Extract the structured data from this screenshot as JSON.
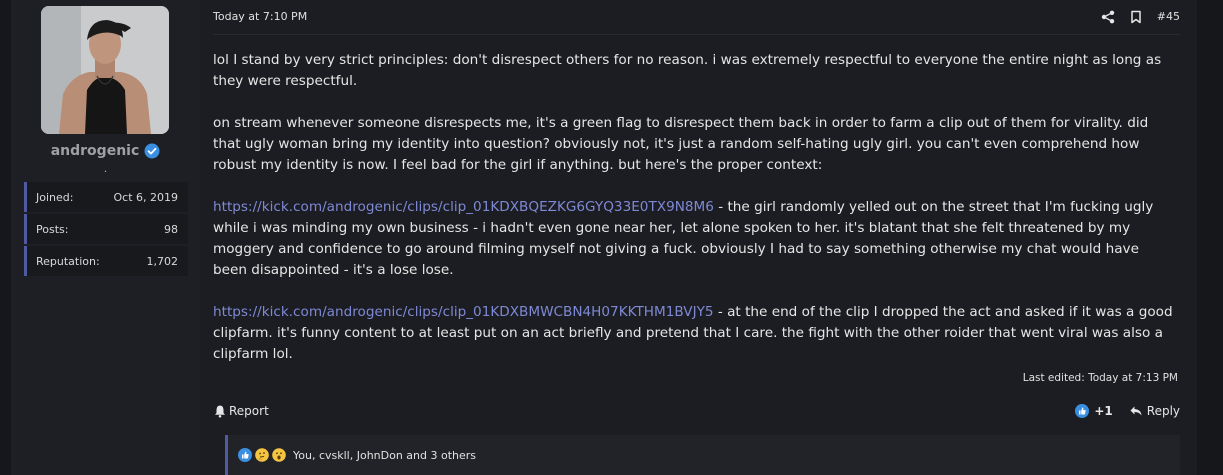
{
  "user": {
    "username": "androgenic",
    "title": ".",
    "stats": [
      {
        "label": "Joined:",
        "value": "Oct 6, 2019"
      },
      {
        "label": "Posts:",
        "value": "98"
      },
      {
        "label": "Reputation:",
        "value": "1,702"
      }
    ]
  },
  "post": {
    "timestamp": "Today at 7:10 PM",
    "number": "#45",
    "paragraphs": {
      "p1": "lol I stand by very strict principles: don't disrespect others for no reason. i was extremely respectful to everyone the entire night as long as they were respectful.",
      "p2": "on stream whenever someone disrespects me, it's a green flag to disrespect them back in order to farm a clip out of them for virality. did that ugly woman bring my identity into question? obviously not, it's just a random self-hating ugly girl. you can't even comprehend how robust my identity is now. I feel bad for the girl if anything. but here's the proper context:",
      "p3_link": "https://kick.com/androgenic/clips/clip_01KDXBQEZKG6GYQ33E0TX9N8M6",
      "p3_text": " - the girl randomly yelled out on the street that I'm fucking ugly while i was minding my own business - i hadn't even gone near her, let alone spoken to her. it's blatant that she felt threatened by my moggery and confidence to go around filming myself not giving a fuck. obviously I had to say something otherwise my chat would have been disappointed - it's a lose lose.",
      "p4_link": "https://kick.com/androgenic/clips/clip_01KDXBMWCBN4H07KKTHM1BVJY5",
      "p4_text": " - at the end of the clip I dropped the act and asked if it was a good clipfarm. it's funny content to at least put on an act briefly and pretend that I care. the fight with the other roider that went viral was also a clipfarm lol."
    },
    "last_edited": "Last edited: Today at 7:13 PM",
    "report_label": "Report",
    "reaction_score": "+1",
    "reply_label": "Reply",
    "reactions_summary": "You, cvskll, JohnDon and 3 others",
    "reaction_icons": [
      "like-emoji",
      "thinking-emoji",
      "surprised-emoji"
    ]
  },
  "colors": {
    "background": "#16171b",
    "panel": "#1e1f24",
    "accent": "#4f5aa0",
    "link": "#7e89d4",
    "verified": "#3b8fe0"
  }
}
